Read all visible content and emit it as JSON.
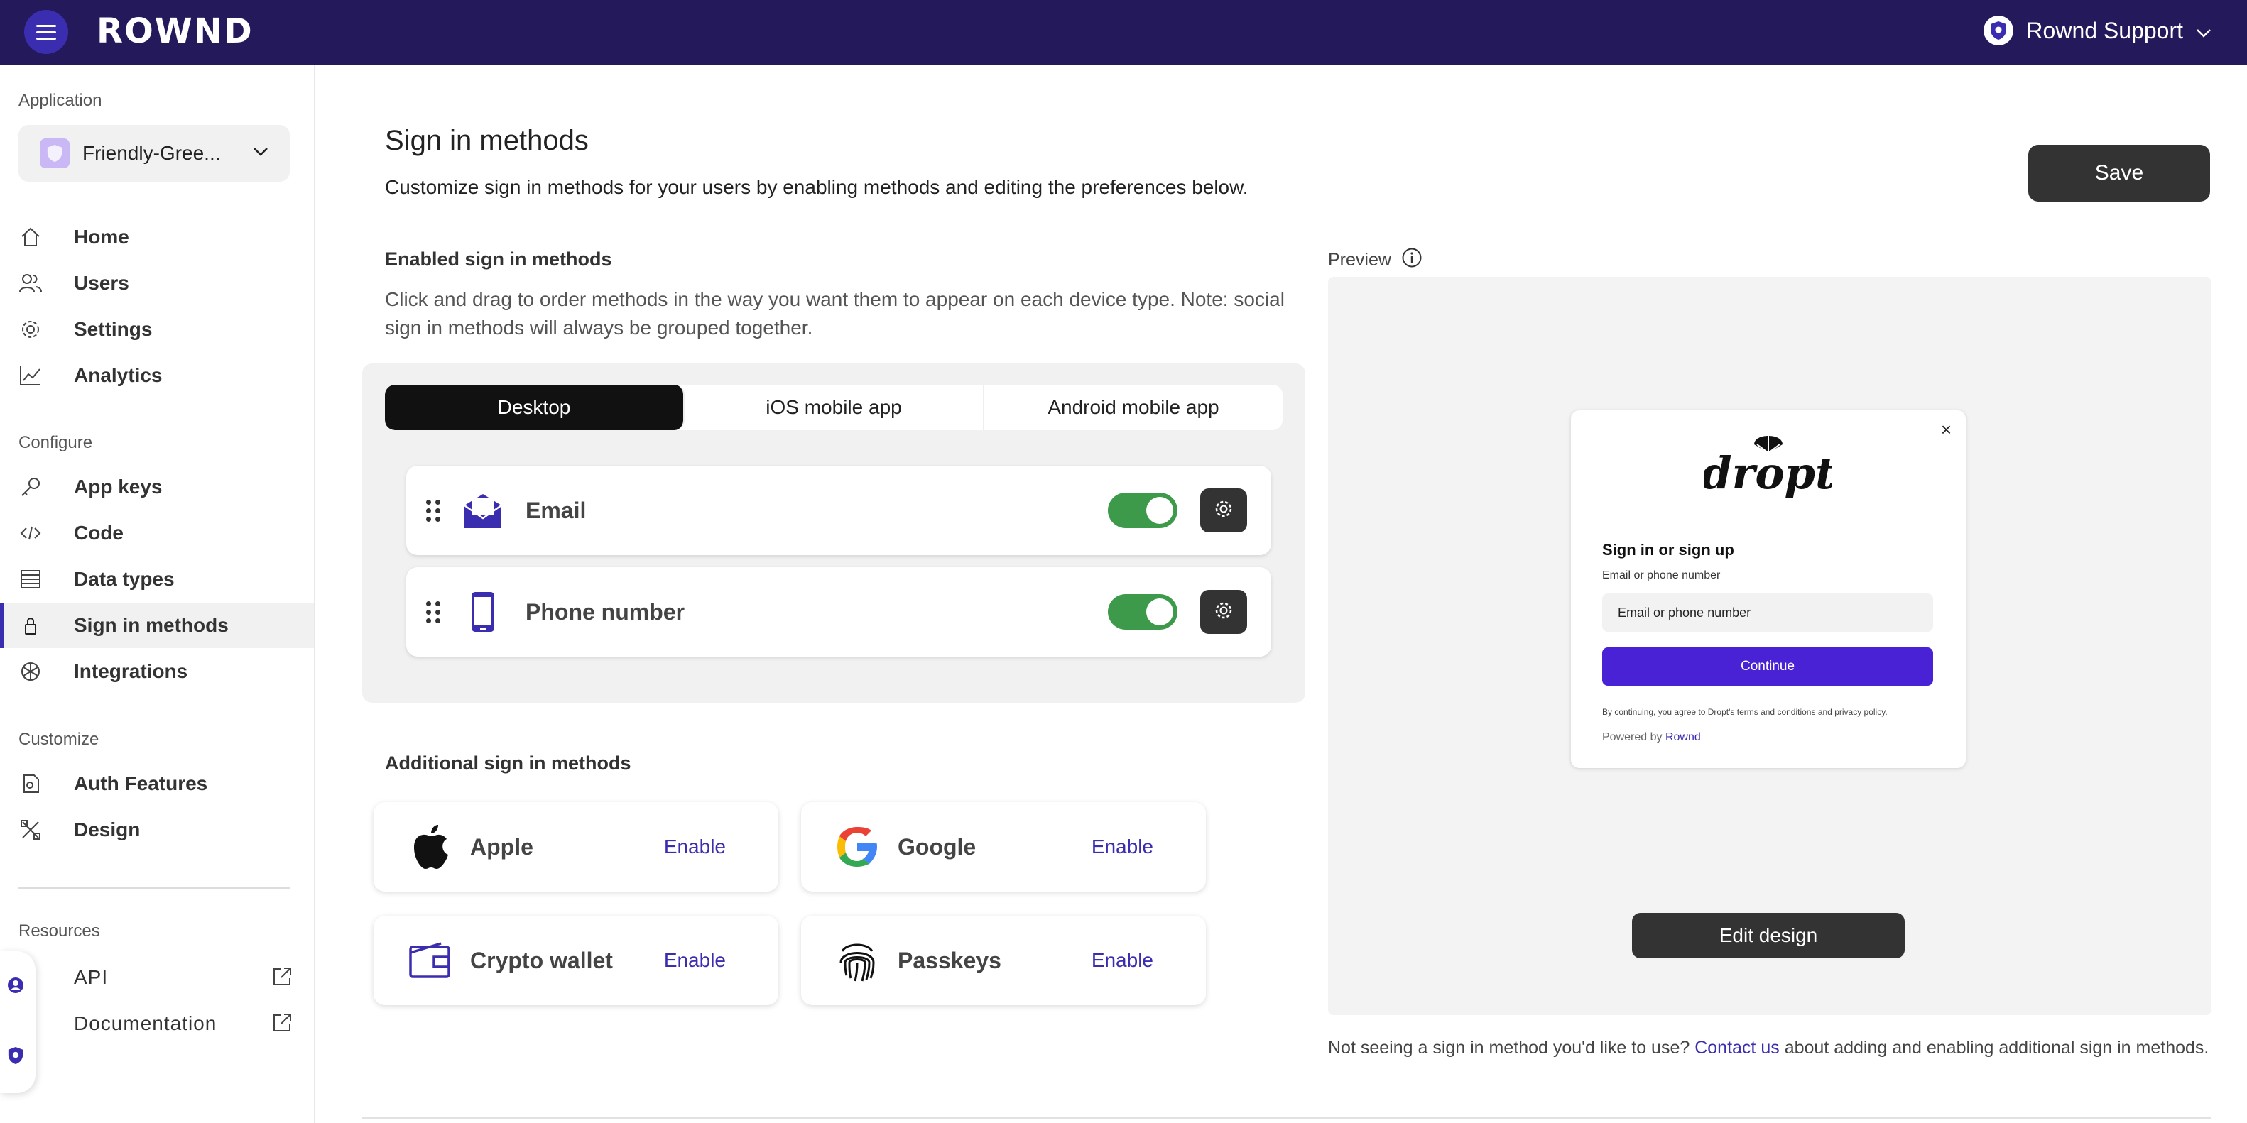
{
  "topbar": {
    "logo": "ROWND",
    "account_name": "Rownd Support"
  },
  "sidebar": {
    "application_label": "Application",
    "app_name": "Friendly-Gree...",
    "main_items": [
      {
        "label": "Home",
        "icon": "home-icon"
      },
      {
        "label": "Users",
        "icon": "users-icon"
      },
      {
        "label": "Settings",
        "icon": "gear-icon"
      },
      {
        "label": "Analytics",
        "icon": "chart-icon"
      }
    ],
    "configure_label": "Configure",
    "configure_items": [
      {
        "label": "App keys",
        "icon": "key-icon"
      },
      {
        "label": "Code",
        "icon": "code-icon"
      },
      {
        "label": "Data types",
        "icon": "list-icon"
      },
      {
        "label": "Sign in methods",
        "icon": "lock-icon",
        "active": true
      },
      {
        "label": "Integrations",
        "icon": "integrations-icon"
      }
    ],
    "customize_label": "Customize",
    "customize_items": [
      {
        "label": "Auth Features",
        "icon": "auth-features-icon"
      },
      {
        "label": "Design",
        "icon": "design-icon"
      }
    ],
    "resources_label": "Resources",
    "resources_items": [
      {
        "label": "API",
        "icon": "api-icon"
      },
      {
        "label": "Documentation",
        "icon": "documentation-icon"
      }
    ]
  },
  "main": {
    "title": "Sign in methods",
    "subtitle": "Customize sign in methods for your users by enabling methods and editing the preferences below.",
    "save_label": "Save",
    "enabled_title": "Enabled sign in methods",
    "enabled_desc": "Click and drag to order methods in the way you want them to appear on each device type. Note: social sign in methods will always be grouped together.",
    "tabs": [
      "Desktop",
      "iOS mobile app",
      "Android mobile app"
    ],
    "active_tab": "Desktop",
    "enabled_methods": [
      {
        "label": "Email",
        "icon": "email-icon",
        "enabled": true
      },
      {
        "label": "Phone number",
        "icon": "phone-icon",
        "enabled": true
      }
    ],
    "additional_title": "Additional sign in methods",
    "additional_methods": [
      {
        "label": "Apple",
        "action": "Enable",
        "icon": "apple-icon"
      },
      {
        "label": "Google",
        "action": "Enable",
        "icon": "google-icon"
      },
      {
        "label": "Crypto wallet",
        "action": "Enable",
        "icon": "wallet-icon"
      },
      {
        "label": "Passkeys",
        "action": "Enable",
        "icon": "fingerprint-icon"
      }
    ]
  },
  "preview": {
    "label": "Preview",
    "brand": "dropt",
    "close": "×",
    "modal_title": "Sign in or sign up",
    "field_label": "Email or phone number",
    "input_value": "Email or phone number",
    "continue_label": "Continue",
    "legal_prefix": "By continuing, you agree to Dropt's",
    "legal_terms": "terms and conditions",
    "legal_and": "and",
    "legal_privacy": "privacy policy",
    "powered_by": "Powered by",
    "powered_brand": "Rownd",
    "edit_design_label": "Edit design"
  },
  "footer": {
    "not_seeing_prefix": "Not seeing a sign in method you'd like to use?",
    "contact_link": "Contact us",
    "not_seeing_suffix": "about adding and enabling additional sign in methods."
  },
  "colors": {
    "topbar": "#24195b",
    "accent": "#3b2db0",
    "toggle_on": "#3d9a4a",
    "dark_button": "#333333"
  }
}
